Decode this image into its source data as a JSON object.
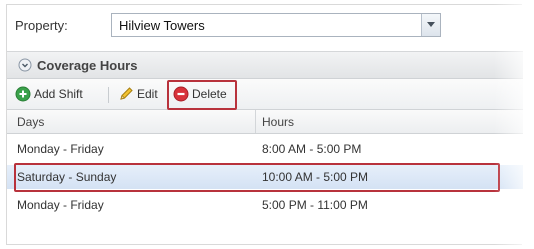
{
  "property": {
    "label": "Property:",
    "selected": "Hilview Towers"
  },
  "panel": {
    "title": "Coverage Hours"
  },
  "toolbar": {
    "add_label": "Add Shift",
    "edit_label": "Edit",
    "delete_label": "Delete"
  },
  "grid": {
    "columns": [
      "Days",
      "Hours"
    ],
    "rows": [
      {
        "days": "Monday - Friday",
        "hours": "8:00 AM - 5:00 PM"
      },
      {
        "days": "Saturday - Sunday",
        "hours": "10:00 AM - 5:00 PM"
      },
      {
        "days": "Monday - Friday",
        "hours": "5:00 PM - 11:00 PM"
      }
    ]
  },
  "colors": {
    "highlight_red": "#b8323c",
    "selected_row": "#d4e2f4",
    "add_green": "#3aa14a",
    "delete_red": "#d8323a"
  },
  "icons": [
    "collapse-icon",
    "dropdown-arrow-icon",
    "add-icon",
    "pencil-icon",
    "delete-icon"
  ]
}
